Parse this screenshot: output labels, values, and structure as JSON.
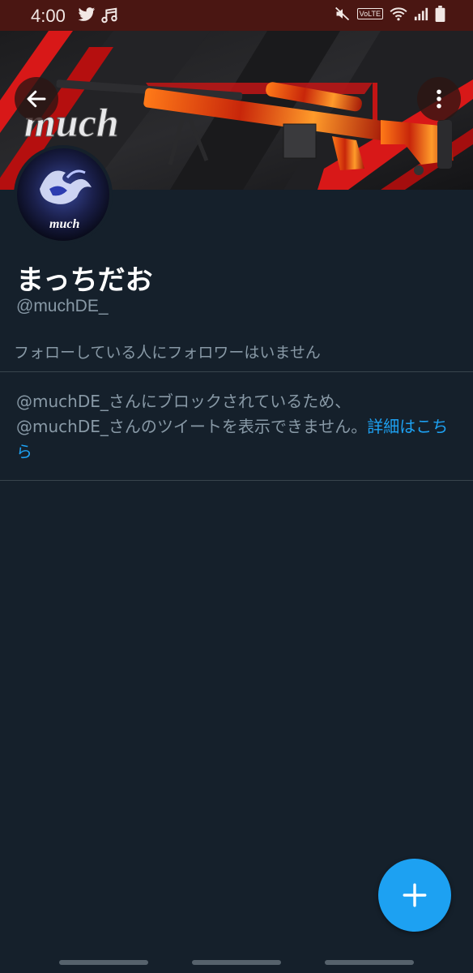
{
  "status_bar": {
    "time": "4:00",
    "left_icons": [
      "twitter-icon",
      "music-note-icon"
    ],
    "right_icons": [
      "mute-icon",
      "volte-badge",
      "wifi-icon",
      "signal-icon",
      "battery-icon"
    ],
    "volte_label": "VoLTE"
  },
  "header": {
    "banner_text": "much",
    "back_icon": "back-arrow-icon",
    "menu_icon": "more-vertical-icon"
  },
  "profile": {
    "avatar_text": "much",
    "display_name": "まっちだお",
    "handle": "@muchDE_",
    "followers_note": "フォローしている人にフォロワーはいません"
  },
  "blocked": {
    "line1": "@muchDE_さんにブロックされているため、",
    "line2": "@muchDE_さんのツイートを表示できません。",
    "link": "詳細はこちら"
  },
  "fab": {
    "icon": "plus-icon"
  },
  "colors": {
    "background": "#15202b",
    "status_bar": "#4a1612",
    "accent": "#1da1f2",
    "secondary_text": "#8899a6",
    "divider": "#38444d"
  }
}
